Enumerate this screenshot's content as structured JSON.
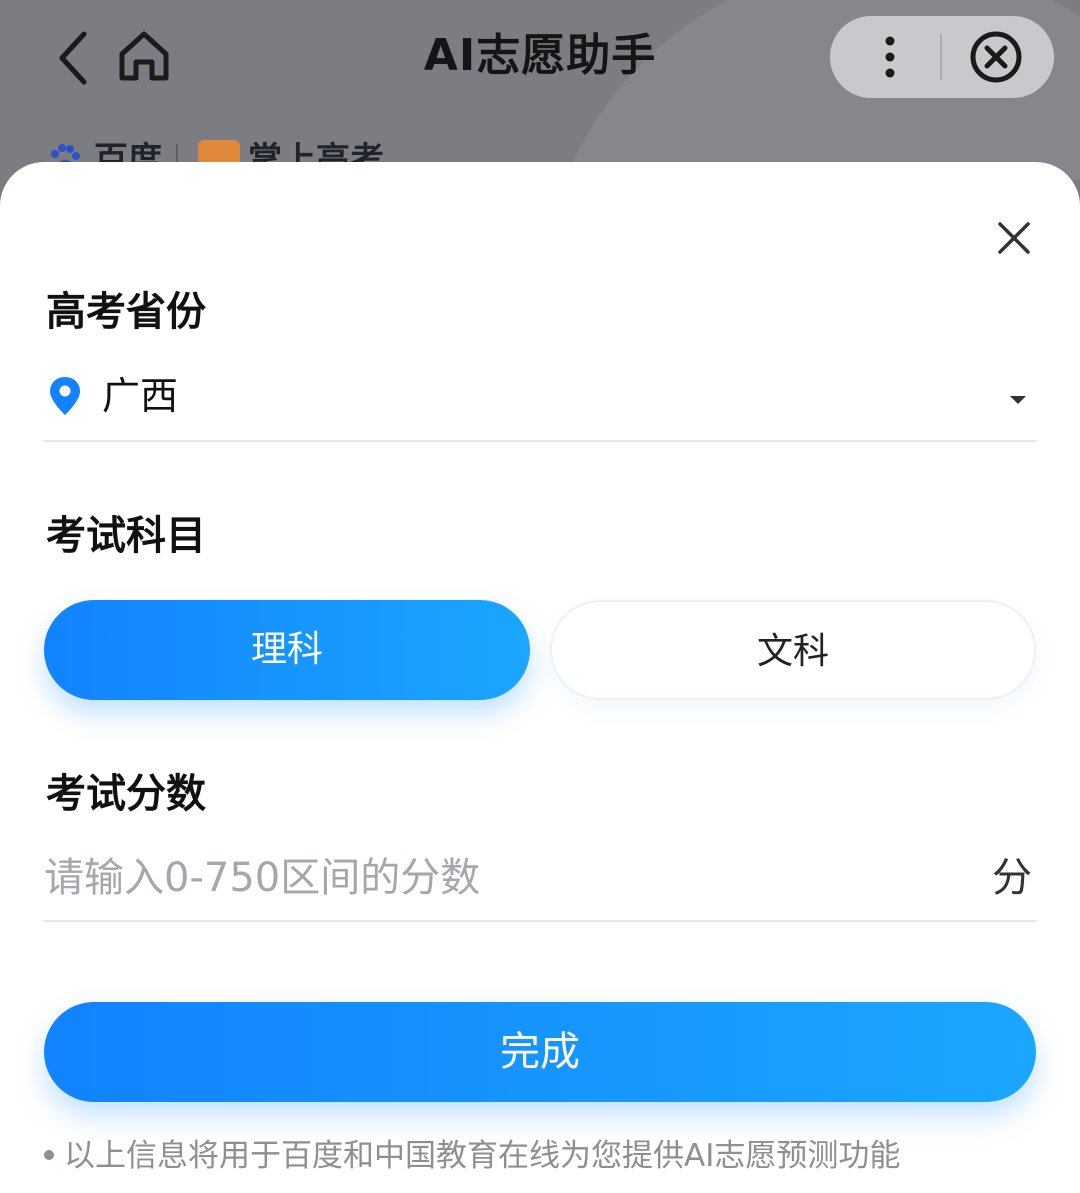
{
  "header": {
    "title": "AI志愿助手",
    "brand_a": "百度",
    "brand_b": "掌上高考"
  },
  "sheet": {
    "province": {
      "label": "高考省份",
      "value": "广西"
    },
    "subject": {
      "label": "考试科目",
      "options": [
        "理科",
        "文科"
      ],
      "selected": "理科"
    },
    "score": {
      "label": "考试分数",
      "placeholder": "请输入0-750区间的分数",
      "unit": "分"
    },
    "done_label": "完成",
    "disclaimer": "以上信息将用于百度和中国教育在线为您提供AI志愿预测功能"
  },
  "colors": {
    "accent_start": "#1283ff",
    "accent_end": "#1ba6ff",
    "pin": "#1482ff"
  },
  "icons": [
    "back-arrow-icon",
    "home-icon",
    "more-vertical-icon",
    "close-circle-icon",
    "baidu-paw-icon",
    "close-icon",
    "location-pin-icon",
    "caret-down-icon"
  ]
}
